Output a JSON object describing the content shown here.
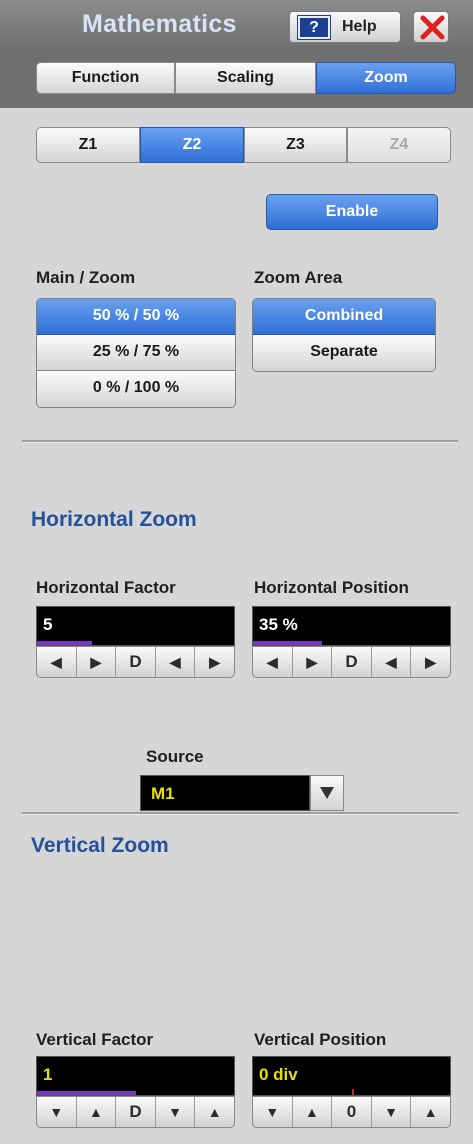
{
  "window": {
    "title": "Mathematics",
    "help_label": "Help",
    "help_icon": "?"
  },
  "tabs": [
    {
      "label": "Function",
      "selected": false
    },
    {
      "label": "Scaling",
      "selected": false
    },
    {
      "label": "Zoom",
      "selected": true
    }
  ],
  "zoom_selector": [
    {
      "label": "Z1",
      "selected": false,
      "enabled": true
    },
    {
      "label": "Z2",
      "selected": true,
      "enabled": true
    },
    {
      "label": "Z3",
      "selected": false,
      "enabled": true
    },
    {
      "label": "Z4",
      "selected": false,
      "enabled": false
    }
  ],
  "enable_label": "Enable",
  "main_zoom": {
    "label": "Main / Zoom",
    "options": [
      "50 % / 50 %",
      "25 % / 75 %",
      "0 % / 100 %"
    ],
    "selected_index": 0
  },
  "zoom_area": {
    "label": "Zoom Area",
    "options": [
      "Combined",
      "Separate"
    ],
    "selected_index": 0
  },
  "horizontal_zoom": {
    "title": "Horizontal Zoom",
    "factor": {
      "label": "Horizontal Factor",
      "value": "5",
      "value_color": "#ffffff",
      "level": 0.28
    },
    "position": {
      "label": "Horizontal Position",
      "value": "35 %",
      "value_color": "#ffffff",
      "level": 0.35
    },
    "arrow_glyphs": [
      "◀",
      "▶",
      "D",
      "◀",
      "▶"
    ]
  },
  "vertical_zoom": {
    "title": "Vertical Zoom",
    "source": {
      "label": "Source",
      "value": "M1"
    },
    "factor": {
      "label": "Vertical Factor",
      "value": "1",
      "value_color": "#e5e000",
      "level": 0.5
    },
    "position": {
      "label": "Vertical Position",
      "value": "0 div",
      "value_color": "#e5e000",
      "level": 0.5
    },
    "arrow_glyphs": [
      "▼",
      "▲",
      "D",
      "▼",
      "▲"
    ],
    "position_arrow_glyphs": [
      "▼",
      "▲",
      "0",
      "▼",
      "▲"
    ]
  },
  "colors": {
    "accent": "#3a7ae0",
    "section_title": "#23519b",
    "level_bar": "#7a34c7",
    "indicator": "#c42a2a"
  }
}
